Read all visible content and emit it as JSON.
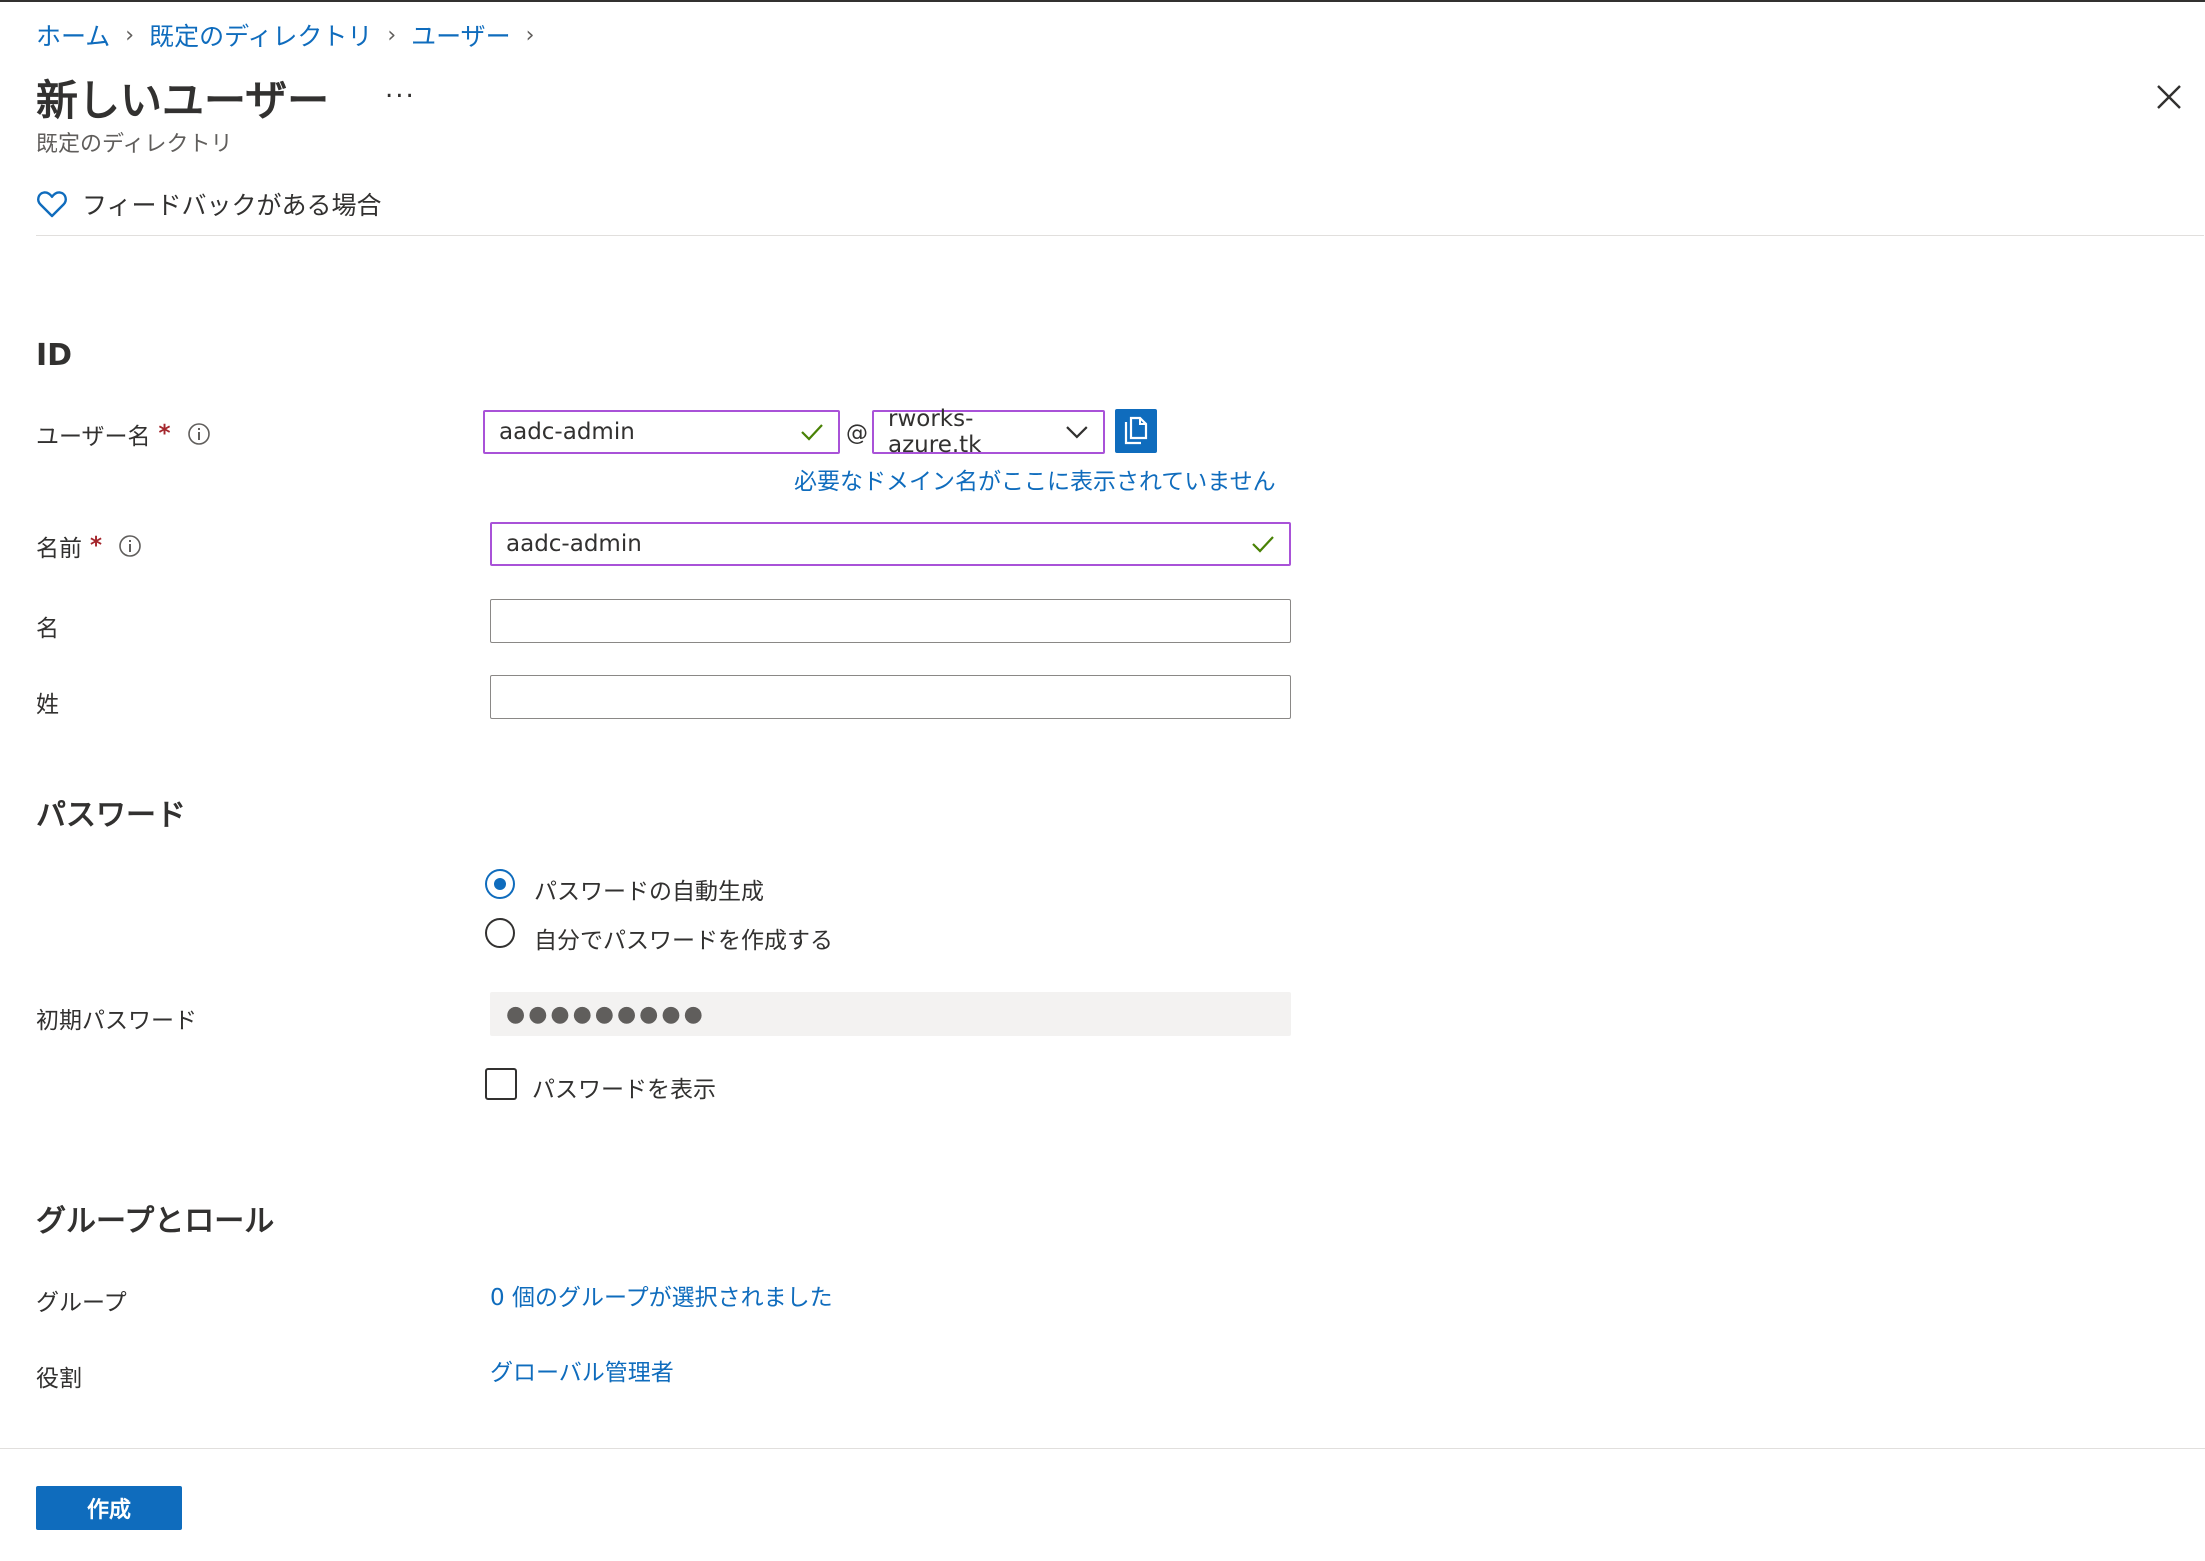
{
  "breadcrumb": [
    "ホーム",
    "既定のディレクトリ",
    "ユーザー"
  ],
  "header": {
    "title": "新しいユーザー",
    "more": "...",
    "subtitle": "既定のディレクトリ"
  },
  "feedback": "フィードバックがある場合",
  "identity": {
    "section": "ID",
    "username_label": "ユーザー名",
    "username_value": "aadc-admin",
    "at_sign": "@",
    "domain_value": "rworks-azure.tk",
    "domain_hint": "必要なドメイン名がここに表示されていません",
    "name_label": "名前",
    "name_value": "aadc-admin",
    "first_name_label": "名",
    "first_name_value": "",
    "last_name_label": "姓",
    "last_name_value": "",
    "required_mark": "*"
  },
  "password": {
    "section": "パスワード",
    "option_auto": "パスワードの自動生成",
    "option_manual": "自分でパスワードを作成する",
    "selected_option": "auto",
    "initial_label": "初期パスワード",
    "initial_value": "●●●●●●●●●",
    "show_label": "パスワードを表示",
    "show_checked": false
  },
  "groups_roles": {
    "section": "グループとロール",
    "groups_label": "グループ",
    "groups_value": "0 個のグループが選択されました",
    "role_label": "役割",
    "role_value": "グローバル管理者"
  },
  "footer": {
    "create_label": "作成"
  },
  "colors": {
    "accent": "#0f6cbd",
    "valid_border": "#a952d8",
    "valid_check": "#498205",
    "required": "#a4262c"
  }
}
